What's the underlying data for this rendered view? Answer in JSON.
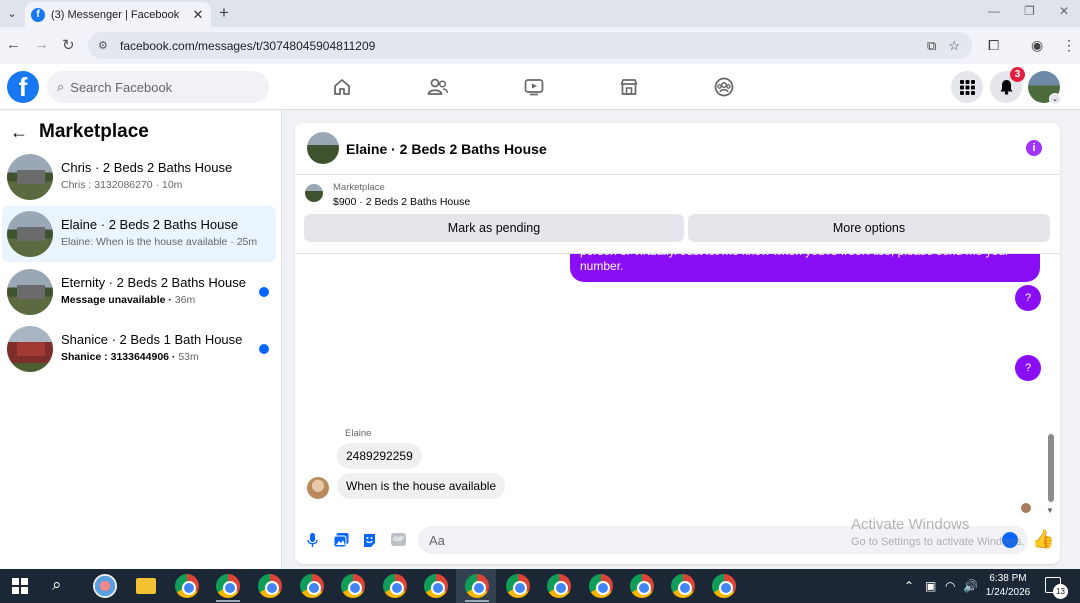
{
  "browser": {
    "tab_title": "(3) Messenger | Facebook",
    "url": "facebook.com/messages/t/30748045904811209"
  },
  "header": {
    "search_placeholder": "Search Facebook",
    "notification_count": "3",
    "nav_icons": [
      "home-icon",
      "friends-icon",
      "watch-icon",
      "marketplace-icon",
      "groups-icon"
    ]
  },
  "sidebar": {
    "title": "Marketplace",
    "conversations": [
      {
        "name": "Chris · 2 Beds 2 Baths House",
        "preview": "Chris : 3132086270",
        "time": "10m",
        "unread": false,
        "active": false
      },
      {
        "name": "Elaine · 2 Beds 2 Baths House",
        "preview": "Elaine: When is the house available",
        "time": "25m",
        "unread": false,
        "active": true
      },
      {
        "name": "Eternity · 2 Beds 2 Baths House",
        "preview": "Message unavailable",
        "time": "36m",
        "unread": true,
        "active": false
      },
      {
        "name": "Shanice · 2 Beds 1 Bath House",
        "preview": "Shanice : 3133644906",
        "time": "53m",
        "unread": true,
        "active": false
      }
    ]
  },
  "chat": {
    "title": "Elaine · 2 Beds 2 Baths House",
    "marketplace_label": "Marketplace",
    "listing": "$900 · 2 Beds 2 Baths House",
    "buttons": {
      "pending": "Mark as pending",
      "more": "More options"
    },
    "outgoing_text": "person or virtually. Just let me know when you're free. Also, please send me your number.",
    "question_mark": "?",
    "sender_name": "Elaine",
    "incoming": [
      "2489292259",
      "When is the house available"
    ],
    "input_placeholder": "Aa"
  },
  "watermark": {
    "line1": "Activate Windows",
    "line2": "Go to Settings to activate Windows."
  },
  "taskbar": {
    "time": "6:38 PM",
    "date": "1/24/2026",
    "notifications": "13"
  },
  "colors": {
    "fb_blue": "#1877f2",
    "messenger_purple": "#8a0ef5",
    "unread_dot": "#0866ff",
    "badge_red": "#e41e3f"
  }
}
